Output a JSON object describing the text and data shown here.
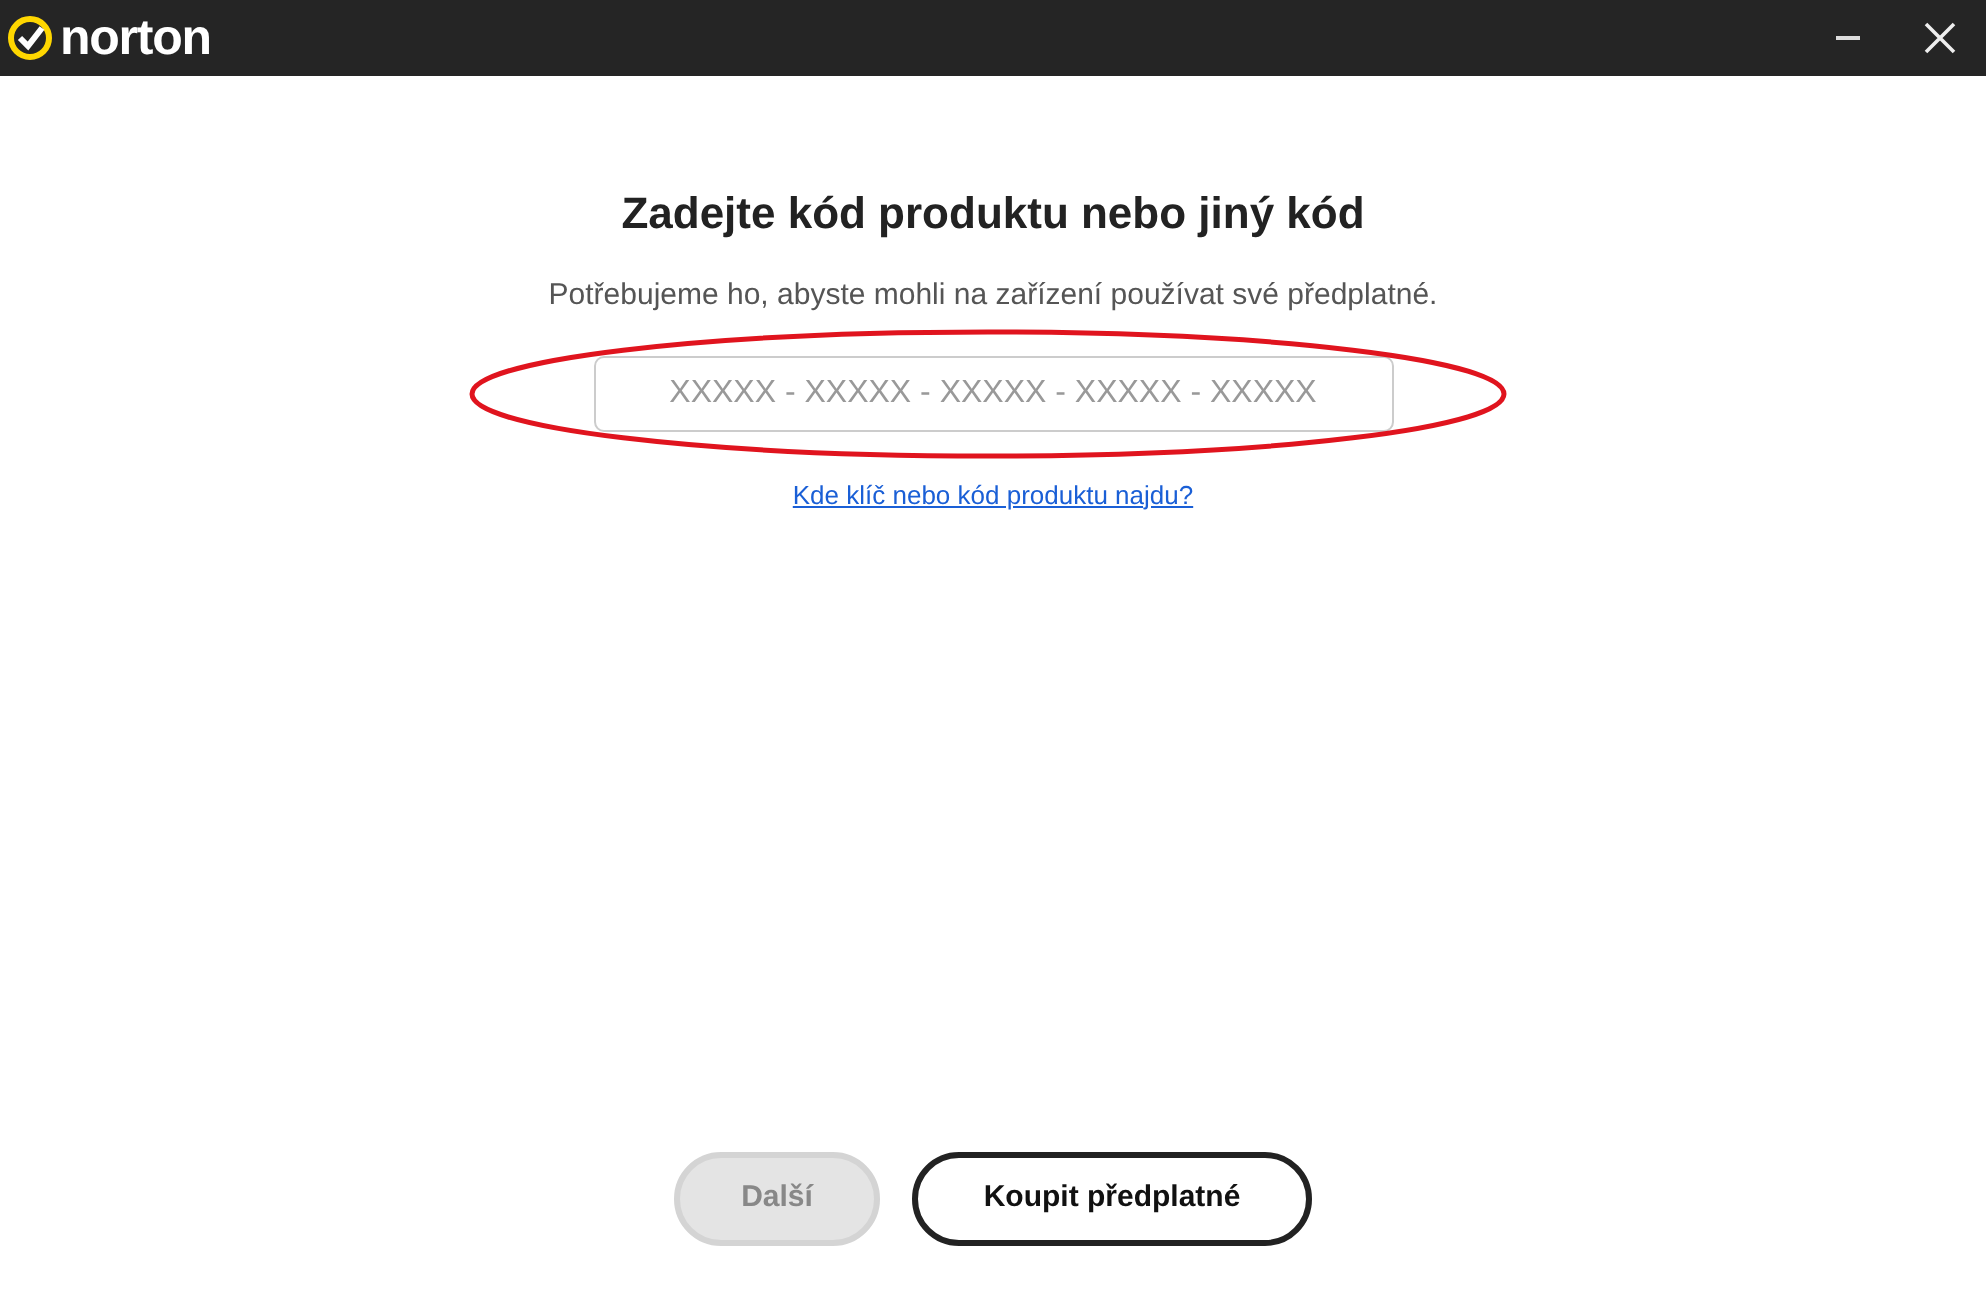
{
  "title_bar": {
    "logo_text": "norton"
  },
  "heading": "Zadejte kód produktu nebo jiný kód",
  "subtitle": "Potřebujeme ho, abyste mohli na zařízení používat své předplatné.",
  "code_field": {
    "placeholder": "XXXXX - XXXXX - XXXXX - XXXXX - XXXXX",
    "highlighted": true
  },
  "help_link": "Kde klíč nebo kód produktu najdu?",
  "buttons": [
    {
      "label": "Další",
      "kind": "primary",
      "disabled": true
    },
    {
      "label": "Koupit předplatné",
      "kind": "outline",
      "disabled": false
    }
  ]
}
